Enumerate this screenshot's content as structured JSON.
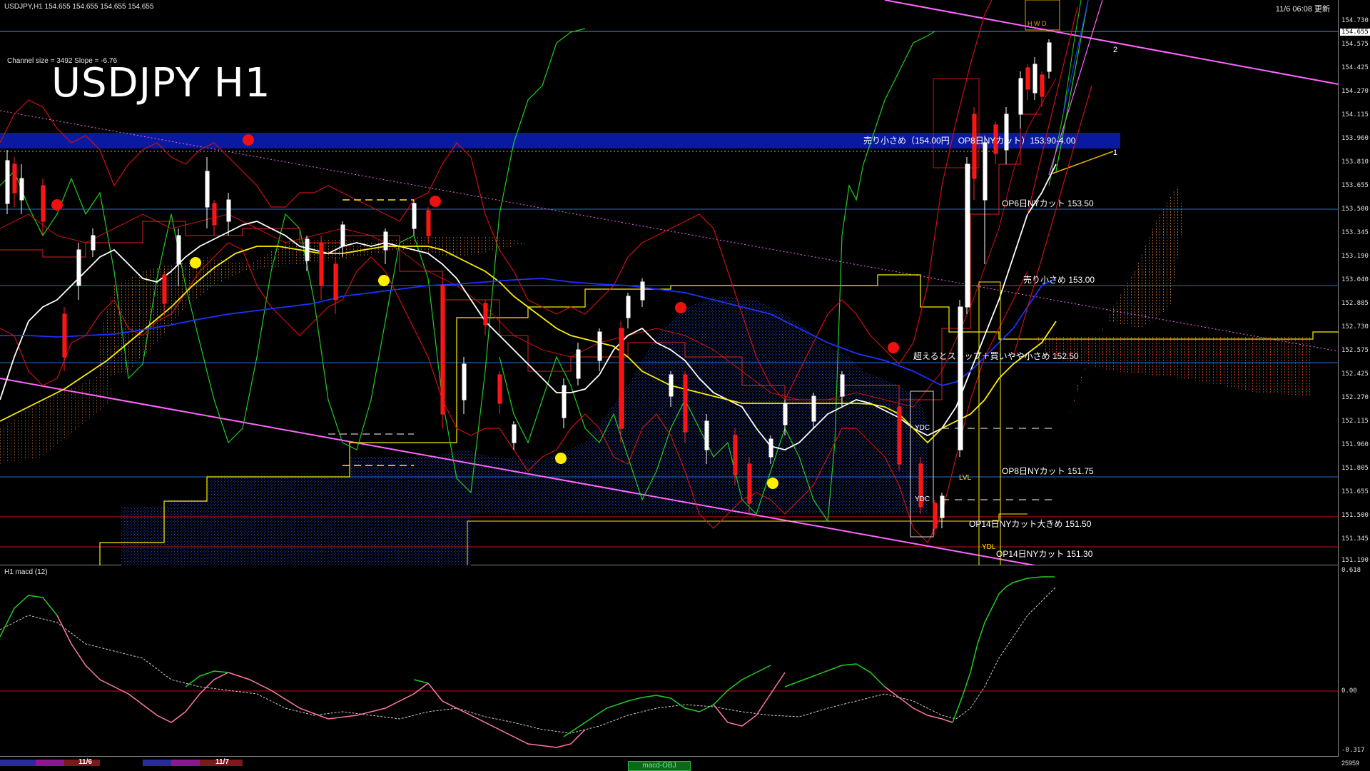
{
  "header": {
    "symbol_info": "USDJPY,H1  154.655 154.655 154.655 154.655",
    "timestamp": "11/6 06:08 更新"
  },
  "channel_info": "Channel size = 3492 Slope = -6.76",
  "title": "USDJPY H1",
  "current_price": "154.655",
  "price_axis": [
    "154.730",
    "154.575",
    "154.425",
    "154.270",
    "154.115",
    "153.960",
    "153.810",
    "153.655",
    "153.500",
    "153.345",
    "153.190",
    "153.040",
    "152.885",
    "152.730",
    "152.575",
    "152.425",
    "152.270",
    "152.115",
    "151.960",
    "151.805",
    "151.655",
    "151.500",
    "151.345",
    "151.190"
  ],
  "annotations": {
    "sell_band": "売り小さめ（154.00円　OP8日NYカット）153.90-4.00",
    "op6": "OP6日NYカット 153.50",
    "sell_small": "売り小さめ 153.00",
    "stop_buy": "超えるとストップ＋買いやや小さめ 152.50",
    "op8": "OP8日NYカット 151.75",
    "op14_big": "OP14日NYカット大きめ 151.50",
    "op14": "OP14日NYカット 151.30",
    "ydc_top": "YDC",
    "ydc_low": "YDC",
    "lvl": "LVL",
    "ydl": "YDL",
    "mark1": "1",
    "mark2": "2",
    "hwd": "H W D"
  },
  "subwindow": {
    "title": "H1  macd (12)",
    "axis_top": "0.618",
    "axis_zero": "0.00",
    "axis_bottom": "-0.317"
  },
  "time_axis": {
    "date1": "11/6",
    "date2": "11/7",
    "tab_label": "macd-OBJ",
    "bottom_value": "25959"
  },
  "colors": {
    "background": "#000000",
    "sell_band": "#0a1aa0",
    "bull_candle": "#ffffff",
    "bear_candle": "#ff0000",
    "ma_short": "#ffffff",
    "ma_mid": "#ffff00",
    "ma_long": "#0022ff",
    "channel": "#ff66ff",
    "macd_main": "#22cc22",
    "macd_neg": "#ff77aa"
  }
}
